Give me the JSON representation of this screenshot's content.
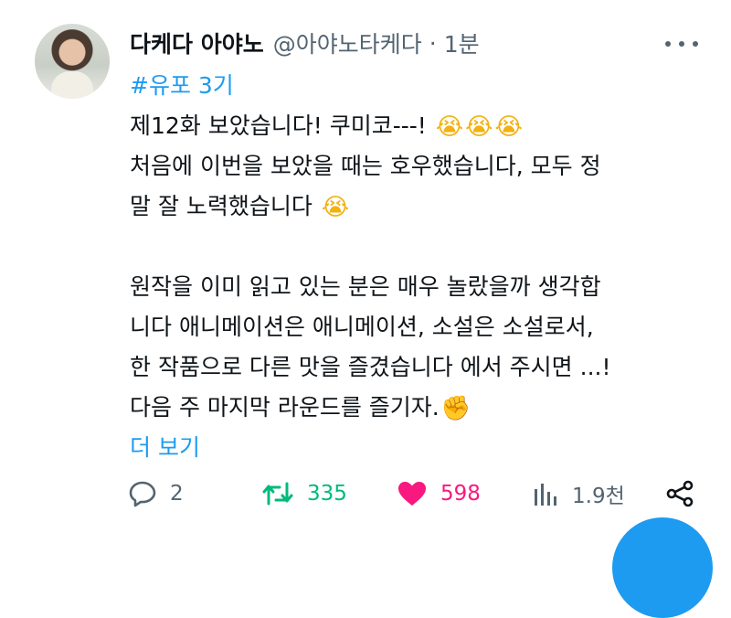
{
  "tweet": {
    "display_name": "다케다 아야노",
    "handle": "@아야노타케다",
    "separator": "·",
    "time": "1분",
    "hashtag": "#유포 3기",
    "lines": [
      "제12화 보았습니다! 쿠미코---!",
      "처음에 이번을 보았을 때는 호우했습니다, 모두 정",
      "말 잘 노력했습니다",
      "원작을 이미 읽고 있는 분은 매우 놀랐을까 생각합",
      "니다 애니메이션은 애니메이션, 소설은 소설로서,",
      "한 작품으로 다른 맛을 즐겼습니다 에서 주시면 ...!",
      "다음 주 마지막 라운드를 즐기자."
    ],
    "emojis": {
      "crying": "😭",
      "fist": "✊"
    },
    "more_link": "더 보기"
  },
  "actions": {
    "reply_count": "2",
    "retweet_count": "335",
    "like_count": "598",
    "view_count": "1.9천"
  },
  "colors": {
    "link": "#1d9bf0",
    "retweet": "#00ba7c",
    "like": "#f91880",
    "muted": "#536471"
  }
}
